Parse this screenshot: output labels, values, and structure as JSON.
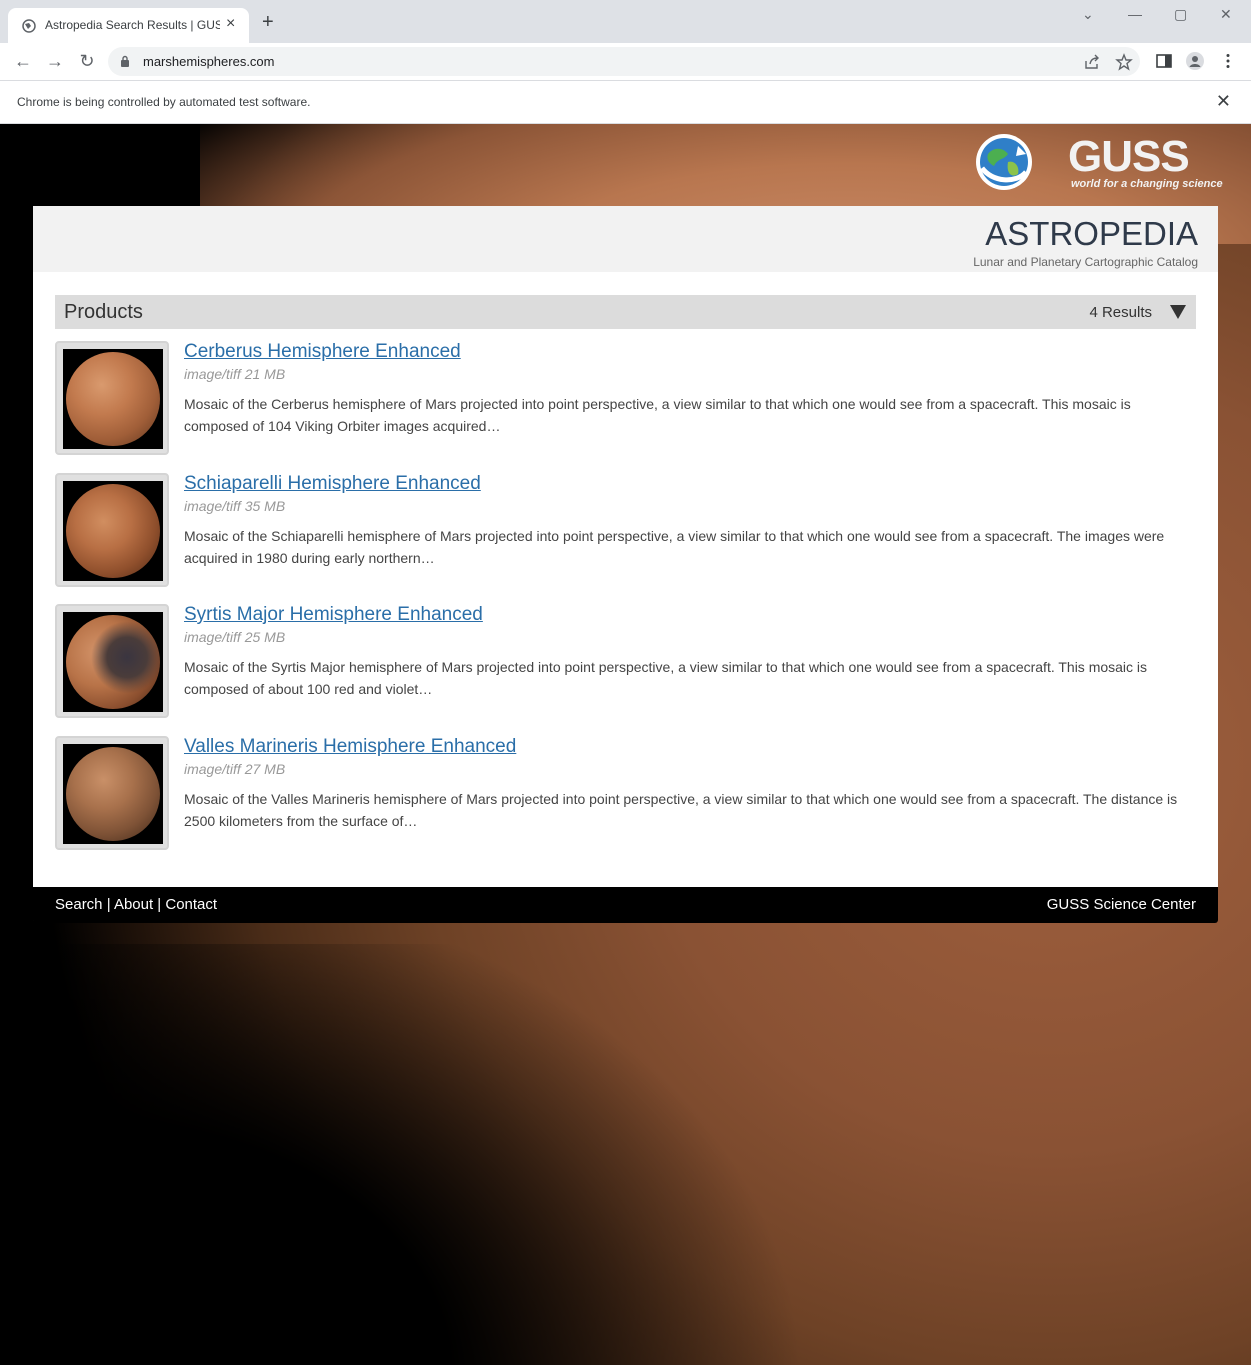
{
  "browser": {
    "tab_title": "Astropedia Search Results | GUSS",
    "url": "marshemispheres.com",
    "infobar_text": "Chrome is being controlled by automated test software."
  },
  "site": {
    "brand": "GUSS",
    "brand_tagline": "world for a changing science",
    "logo_text": "ASTROPEDIA",
    "logo_subtitle": "Lunar and Planetary Cartographic Catalog"
  },
  "products": {
    "title": "Products",
    "results": "4 Results",
    "items": [
      {
        "title": "Cerberus Hemisphere Enhanced",
        "meta": "image/tiff 21 MB",
        "description": "Mosaic of the Cerberus hemisphere of Mars projected into point perspective, a view similar to that which one would see from a spacecraft. This mosaic is composed of 104 Viking Orbiter images acquired…"
      },
      {
        "title": "Schiaparelli Hemisphere Enhanced",
        "meta": "image/tiff 35 MB",
        "description": "Mosaic of the Schiaparelli hemisphere of Mars projected into point perspective, a view similar to that which one would see from a spacecraft. The images were acquired in 1980 during early northern…"
      },
      {
        "title": "Syrtis Major Hemisphere Enhanced",
        "meta": "image/tiff 25 MB",
        "description": "Mosaic of the Syrtis Major hemisphere of Mars projected into point perspective, a view similar to that which one would see from a spacecraft. This mosaic is composed of about 100 red and violet…"
      },
      {
        "title": "Valles Marineris Hemisphere Enhanced",
        "meta": "image/tiff 27 MB",
        "description": "Mosaic of the Valles Marineris hemisphere of Mars projected into point perspective, a view similar to that which one would see from a spacecraft. The distance is 2500 kilometers from the surface of…"
      }
    ]
  },
  "footer": {
    "search": "Search",
    "about": "About",
    "contact": "Contact",
    "separator": " | ",
    "right_text": "GUSS Science Center"
  },
  "colors": {
    "link": "#2a6ea8",
    "products_bar": "#dcdcdc",
    "footer_bg": "#000000"
  }
}
